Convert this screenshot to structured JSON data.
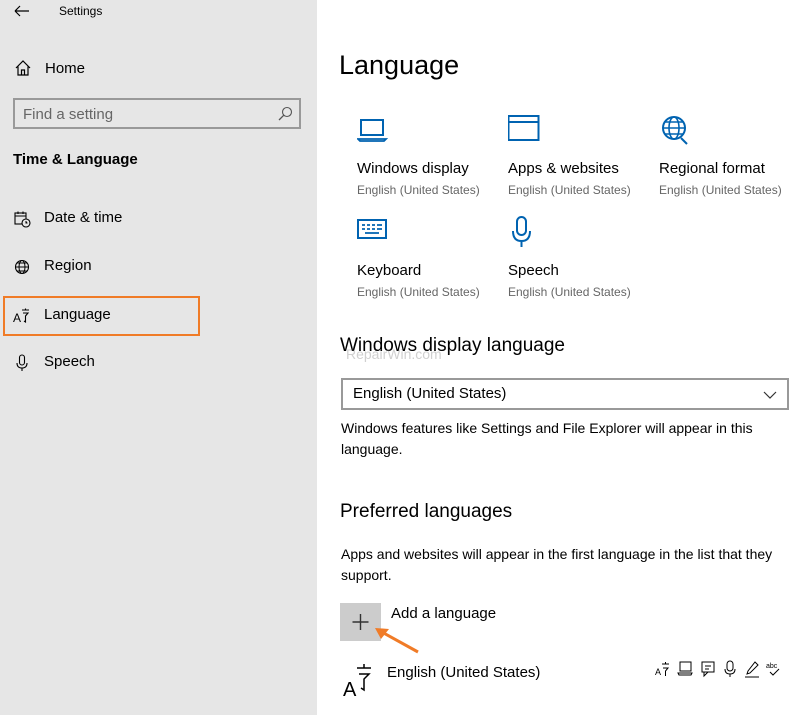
{
  "window": {
    "title": "Settings"
  },
  "sidebar": {
    "home_label": "Home",
    "search_placeholder": "Find a setting",
    "section_title": "Time & Language",
    "items": [
      {
        "label": "Date & time",
        "icon": "calendar-clock-icon"
      },
      {
        "label": "Region",
        "icon": "globe-icon"
      },
      {
        "label": "Language",
        "icon": "language-icon",
        "selected": true
      },
      {
        "label": "Speech",
        "icon": "microphone-icon"
      }
    ]
  },
  "main": {
    "title": "Language",
    "tiles": [
      {
        "name": "Windows display",
        "sub": "English (United States)",
        "icon": "laptop-icon"
      },
      {
        "name": "Apps & websites",
        "sub": "English (United States)",
        "icon": "window-icon"
      },
      {
        "name": "Regional format",
        "sub": "English (United States)",
        "icon": "globe-icon"
      },
      {
        "name": "Keyboard",
        "sub": "English (United States)",
        "icon": "keyboard-icon"
      },
      {
        "name": "Speech",
        "sub": "English (United States)",
        "icon": "microphone-icon"
      }
    ],
    "display_language": {
      "heading": "Windows display language",
      "selected": "English (United States)",
      "description": "Windows features like Settings and File Explorer will appear in this language."
    },
    "preferred": {
      "heading": "Preferred languages",
      "description": "Apps and websites will appear in the first language in the list that they support.",
      "add_label": "Add a language",
      "languages": [
        {
          "name": "English (United States)"
        }
      ]
    },
    "watermark": "RepairWin.com"
  },
  "colors": {
    "accent": "#0063b1",
    "highlight": "#f07b27",
    "sidebar_bg": "#e6e6e6"
  }
}
